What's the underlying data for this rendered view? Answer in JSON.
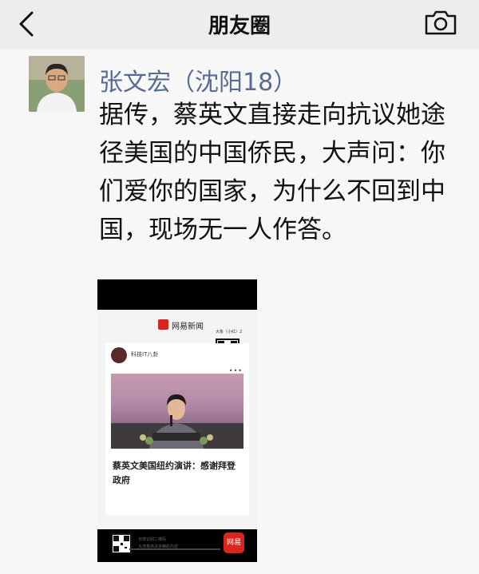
{
  "header": {
    "title": "朋友圈",
    "back_icon": "chevron-left-icon",
    "camera_icon": "camera-icon"
  },
  "post": {
    "author": "张文宏（沈阳18）",
    "text": "据传，蔡英文直接走向抗议她途径美国的中国侨民，大声问：你们爱你的国家，为什么不回到中国，现场无一人作答。",
    "video": {
      "brand": "网易新闻",
      "channel": "科技IT八卦",
      "headline": "蔡英文美国纽约演讲：感谢拜登政府",
      "qr_hint_line1": "长按识别二维码",
      "qr_hint_line2": "大流量高清多精彩内容",
      "app_icon_label": "网易",
      "qr_top_label": "大象（小红）2",
      "progress": 0.05
    }
  },
  "colors": {
    "author": "#576b95",
    "netease_red": "#d8261f",
    "topbar_bg": "#ededed"
  }
}
